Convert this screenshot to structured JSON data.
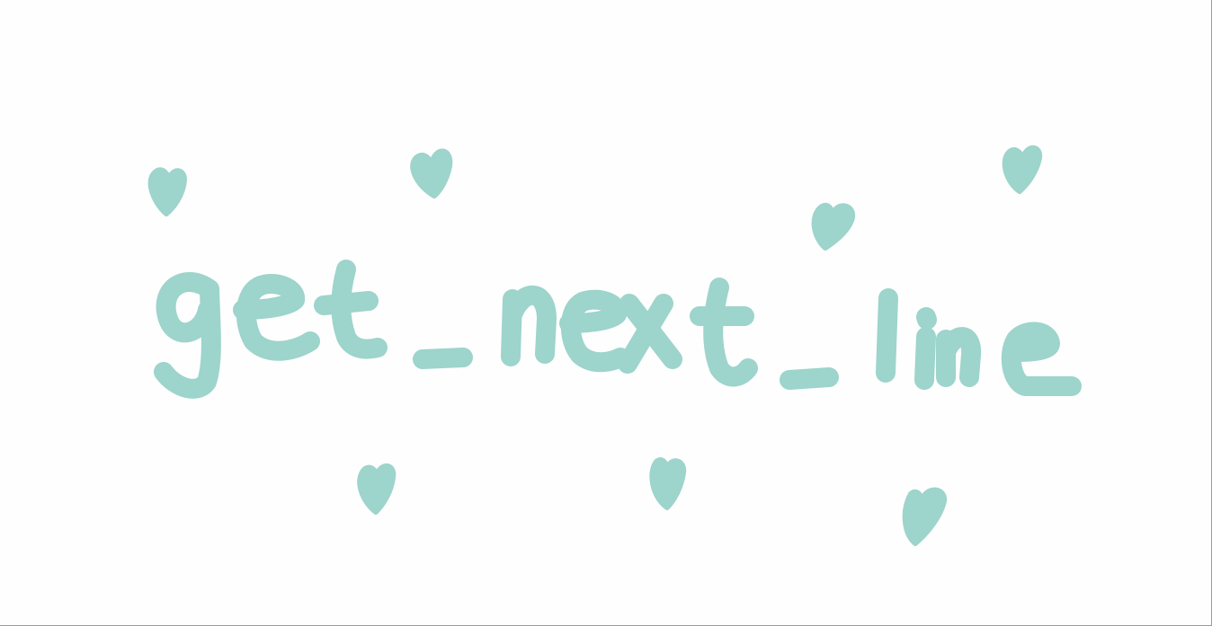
{
  "artwork": {
    "title_text": "get_next_line",
    "ink_color": "#9dd4cc",
    "background_color": "#fefefe",
    "decorations": "heart-icon"
  }
}
